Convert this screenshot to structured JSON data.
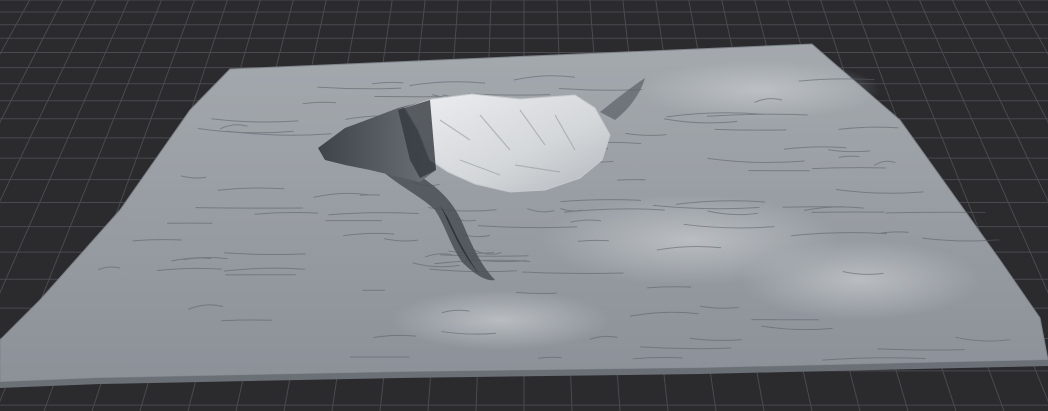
{
  "viewport": {
    "background_color": "#2b2b2e",
    "grid_color": "#4a4a4f",
    "grid_major_color": "#55555a",
    "grid_enabled": true
  },
  "terrain": {
    "object": "terrain-mesh",
    "surface_color": "#9ea3a9",
    "highlight_color": "#d4d7db",
    "shadow_color": "#4f545b",
    "features": [
      "mesa-plateau",
      "canyon",
      "eroded-plain"
    ]
  }
}
